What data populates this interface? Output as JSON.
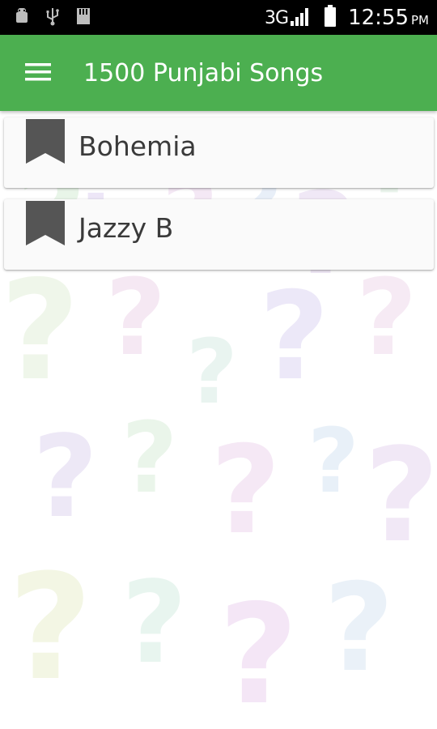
{
  "status_bar": {
    "network_type": "3G",
    "time": "12:55",
    "time_suffix": "PM",
    "icons": [
      "android-debug-icon",
      "usb-icon",
      "sd-card-icon",
      "signal-icon",
      "battery-icon"
    ]
  },
  "app_bar": {
    "title": "1500 Punjabi Songs",
    "menu_icon": "hamburger-menu-icon"
  },
  "list": {
    "items": [
      {
        "label": "Bohemia",
        "icon": "bookmark-icon"
      },
      {
        "label": "Jazzy B",
        "icon": "bookmark-icon"
      }
    ]
  },
  "colors": {
    "app_bar": "#4caf50",
    "status_bar": "#000000",
    "item_text": "#3a3a3a",
    "bookmark": "#555555",
    "card": "#fafafa"
  }
}
